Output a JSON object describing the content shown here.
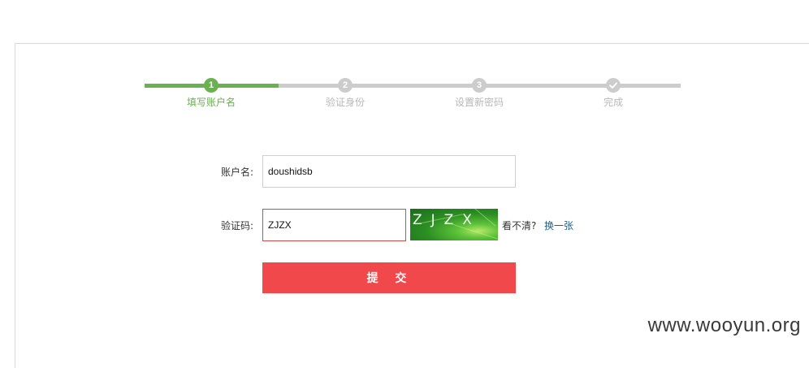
{
  "stepper": {
    "steps": [
      {
        "number": "1",
        "label": "填写账户名",
        "state": "active"
      },
      {
        "number": "2",
        "label": "验证身份",
        "state": "pending"
      },
      {
        "number": "3",
        "label": "设置新密码",
        "state": "pending"
      },
      {
        "icon": "check-icon",
        "label": "完成",
        "state": "pending"
      }
    ],
    "colors": {
      "active": "#6ab150",
      "pending": "#cccccc"
    }
  },
  "form": {
    "account": {
      "label": "账户名:",
      "value": "doushidsb"
    },
    "captcha": {
      "label": "验证码:",
      "value": "ZJZX",
      "image_text": "ZJZX",
      "hint": "看不清?",
      "refresh_label": "换一张"
    },
    "submit_label": "提 交",
    "submit_color": "#f0484b"
  },
  "watermark": "www.wooyun.org"
}
